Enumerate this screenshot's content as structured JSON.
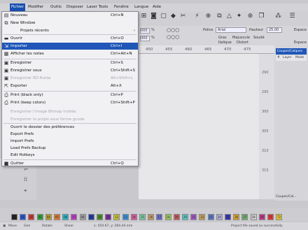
{
  "menubar": {
    "items": [
      "Fichier",
      "Modifier",
      "Outils",
      "Disposer",
      "Laser Tools",
      "Fenêtre",
      "Langue",
      "Aide"
    ],
    "active": "Fichier"
  },
  "toolbar": {
    "icons": [
      "grid-icon",
      "camera-icon",
      "frame-icon",
      "node-icon",
      "scissors-icon",
      "weld-icon",
      "boolean-icon",
      "offset-icon",
      "triangle-icon",
      "star-icon",
      "optimize-icon",
      "duplicate-icon",
      "array-icon",
      "align-icon"
    ]
  },
  "propbar": {
    "x_value": "000",
    "y_value": "000",
    "unit": "%",
    "police_label": "Police",
    "police_value": "Arial",
    "hauteur_label": "Hauteur",
    "hauteur_value": "25.00",
    "espace_label": "Espace",
    "gras": "Gras",
    "italique": "Italique",
    "majuscule": "Majuscule",
    "distort": "Distort",
    "soude": "Soudé"
  },
  "ruler": {
    "labels": [
      "450",
      "455",
      "460",
      "465",
      "470",
      "475"
    ]
  },
  "vruler": {
    "labels": [
      "290",
      "295",
      "300",
      "305",
      "310",
      "315"
    ]
  },
  "rightpanel": {
    "title": "Coupes/Calques",
    "col_hash": "#",
    "col_layer": "Layer",
    "col_mode": "Mode",
    "footer": "Coupes/Cal..."
  },
  "filemenu": {
    "items": [
      {
        "label": "Nouveau",
        "shortcut": "Ctrl+N",
        "icon": "new-document-icon",
        "state": "normal"
      },
      {
        "label": "New Window",
        "shortcut": "",
        "icon": "new-window-icon",
        "state": "normal"
      },
      {
        "label": "Projets récents",
        "shortcut": "",
        "icon": "",
        "state": "submenu"
      },
      {
        "label": "Ouvrir",
        "shortcut": "Ctrl+O",
        "icon": "folder-icon",
        "state": "normal"
      },
      {
        "label": "Importer",
        "shortcut": "Ctrl+I",
        "icon": "import-icon",
        "state": "highlight"
      },
      {
        "label": "Afficher les notes",
        "shortcut": "Ctrl+Alt+N",
        "icon": "notes-icon",
        "state": "normal"
      },
      {
        "label": "Enregistrer",
        "shortcut": "Ctrl+S",
        "icon": "save-icon",
        "state": "normal"
      },
      {
        "label": "Enregistrer sous",
        "shortcut": "Ctrl+Shift+S",
        "icon": "save-as-icon",
        "state": "normal"
      },
      {
        "label": "Enregistrer RD Ruida",
        "shortcut": "Alt+Shift+L",
        "icon": "save-rd-icon",
        "state": "disabled"
      },
      {
        "label": "Exporter",
        "shortcut": "Alt+X",
        "icon": "export-icon",
        "state": "normal"
      },
      {
        "label": "Print (black only)",
        "shortcut": "Ctrl+P",
        "icon": "printer-icon",
        "state": "normal"
      },
      {
        "label": "Print (keep colors)",
        "shortcut": "Ctrl+Shift+P",
        "icon": "printer-color-icon",
        "state": "normal"
      },
      {
        "label": "Enregistrer l'image Bitmap traitée",
        "shortcut": "",
        "icon": "",
        "state": "disabled"
      },
      {
        "label": "Enregistrer le projet sous forme gcode",
        "shortcut": "",
        "icon": "",
        "state": "disabled"
      },
      {
        "label": "Ouvrir le dossier des préférences",
        "shortcut": "",
        "icon": "",
        "state": "normal"
      },
      {
        "label": "Export Prefs",
        "shortcut": "",
        "icon": "",
        "state": "normal"
      },
      {
        "label": "Import Prefs",
        "shortcut": "",
        "icon": "",
        "state": "normal"
      },
      {
        "label": "Load Prefs Backup",
        "shortcut": "",
        "icon": "",
        "state": "normal"
      },
      {
        "label": "Edit Hotkeys",
        "shortcut": "",
        "icon": "",
        "state": "normal"
      },
      {
        "label": "Quitter",
        "shortcut": "Ctrl+Q",
        "icon": "quit-icon",
        "state": "normal"
      }
    ]
  },
  "palette": {
    "swatches": [
      {
        "label": "00",
        "color": "#222222"
      },
      {
        "label": "01",
        "color": "#2a55d6"
      },
      {
        "label": "02",
        "color": "#d23a3a"
      },
      {
        "label": "03",
        "color": "#2fa33a"
      },
      {
        "label": "04",
        "color": "#b8a02a"
      },
      {
        "label": "05",
        "color": "#e07a2c"
      },
      {
        "label": "06",
        "color": "#2ab6c7"
      },
      {
        "label": "07",
        "color": "#c23fc7"
      },
      {
        "label": "08",
        "color": "#a0a0a0"
      },
      {
        "label": "09",
        "color": "#1e3fa6"
      },
      {
        "label": "10",
        "color": "#4d8f2b"
      },
      {
        "label": "11",
        "color": "#7a2f9e"
      },
      {
        "label": "12",
        "color": "#c7c232"
      },
      {
        "label": "13",
        "color": "#3a8fd6"
      },
      {
        "label": "14",
        "color": "#d65a9e"
      },
      {
        "label": "15",
        "color": "#7ac7a0"
      },
      {
        "label": "16",
        "color": "#c79a6a"
      },
      {
        "label": "17",
        "color": "#6a6ac7"
      },
      {
        "label": "18",
        "color": "#9ec75a"
      },
      {
        "label": "19",
        "color": "#c75a5a"
      },
      {
        "label": "20",
        "color": "#5ac7c7"
      },
      {
        "label": "21",
        "color": "#a05ac7"
      },
      {
        "label": "22",
        "color": "#c7a05a"
      },
      {
        "label": "23",
        "color": "#5a7ac7"
      },
      {
        "label": "24",
        "color": "#b0b0d8"
      },
      {
        "label": "25",
        "color": "#3a3ab0"
      },
      {
        "label": "26",
        "color": "#d8a030"
      },
      {
        "label": "27",
        "color": "#6fb06f"
      },
      {
        "label": "28",
        "color": "#d0d0d0"
      },
      {
        "label": "29",
        "color": "#c23a8f"
      },
      {
        "label": "T1",
        "color": "#e23a3a"
      },
      {
        "label": "T2",
        "color": "#e0c03a"
      }
    ]
  },
  "statusbar": {
    "move": "Move",
    "size": "Size",
    "rotate": "Rotate",
    "shear": "Shear",
    "coords": "x: 450.67, y: 284.44 mm",
    "message": "Project file saved as successfully"
  }
}
